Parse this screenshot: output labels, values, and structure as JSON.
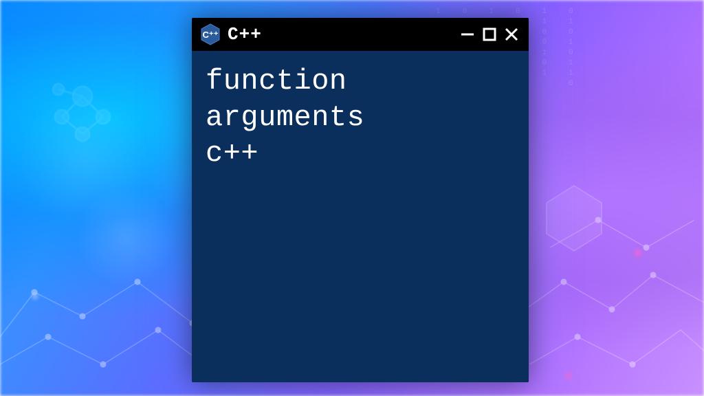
{
  "window": {
    "title": "C++",
    "content": "function\narguments\nc++",
    "icon_name": "cpp-icon"
  },
  "controls": {
    "minimize": "minimize",
    "maximize": "maximize",
    "close": "close"
  },
  "colors": {
    "window_bg": "#0a2f5c",
    "titlebar_bg": "#000000",
    "text": "#ffffff"
  }
}
